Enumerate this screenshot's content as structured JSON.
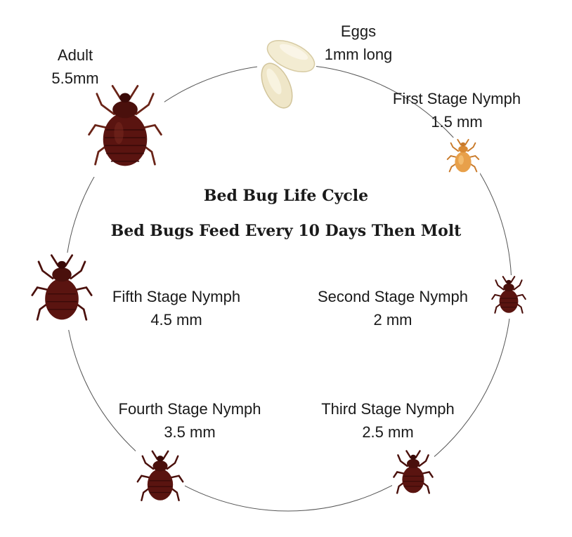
{
  "title": "Bed Bug Life Cycle",
  "subtitle": "Bed Bugs Feed Every 10 Days Then Molt",
  "stages": {
    "eggs": {
      "name": "Eggs",
      "size": "1mm long"
    },
    "first": {
      "name": "First Stage Nymph",
      "size": "1.5 mm"
    },
    "second": {
      "name": "Second Stage Nymph",
      "size": "2 mm"
    },
    "third": {
      "name": "Third Stage Nymph",
      "size": "2.5 mm"
    },
    "fourth": {
      "name": "Fourth Stage Nymph",
      "size": "3.5 mm"
    },
    "fifth": {
      "name": "Fifth Stage Nymph",
      "size": "4.5 mm"
    },
    "adult": {
      "name": "Adult",
      "size": "5.5mm"
    }
  },
  "colors": {
    "ring": "#555555",
    "bug_body": "#5a1410",
    "bug_dark": "#3a0a08",
    "nymph_first": "#e8a04a",
    "egg": "#f3ecd2"
  }
}
